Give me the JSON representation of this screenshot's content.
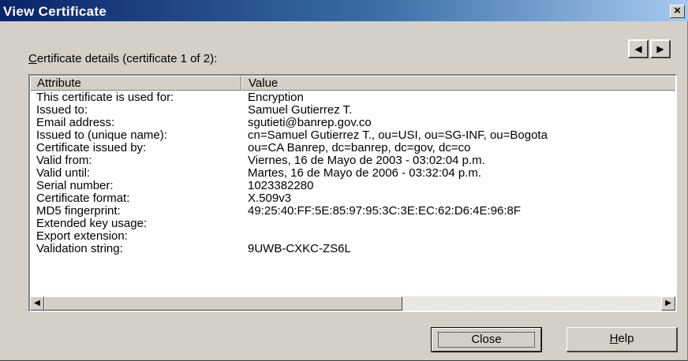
{
  "window": {
    "title": "View Certificate",
    "close_glyph": "×"
  },
  "details": {
    "label_accesskey": "C",
    "label_rest": "ertificate details (certificate 1 of 2):",
    "prev_glyph": "◀",
    "next_glyph": "▶"
  },
  "table": {
    "columns": [
      "Attribute",
      "Value"
    ],
    "rows": [
      {
        "attr": "This certificate is used for:",
        "value": "Encryption"
      },
      {
        "attr": "Issued to:",
        "value": "Samuel Gutierrez T."
      },
      {
        "attr": "Email address:",
        "value": "sgutieti@banrep.gov.co"
      },
      {
        "attr": "Issued to (unique name):",
        "value": "cn=Samuel Gutierrez T., ou=USI, ou=SG-INF, ou=Bogota"
      },
      {
        "attr": "Certificate issued by:",
        "value": "ou=CA Banrep, dc=banrep, dc=gov, dc=co"
      },
      {
        "attr": "Valid from:",
        "value": "Viernes, 16 de Mayo de 2003 - 03:02:04 p.m."
      },
      {
        "attr": "Valid until:",
        "value": "Martes, 16 de Mayo de 2006 - 03:32:04 p.m."
      },
      {
        "attr": "Serial number:",
        "value": "1023382280"
      },
      {
        "attr": "Certificate format:",
        "value": "X.509v3"
      },
      {
        "attr": "MD5 fingerprint:",
        "value": "49:25:40:FF:5E:85:97:95:3C:3E:EC:62:D6:4E:96:8F"
      },
      {
        "attr": "Extended key usage:",
        "value": ""
      },
      {
        "attr": "Export extension:",
        "value": ""
      },
      {
        "attr": "Validation string:",
        "value": "9UWB-CXKC-ZS6L"
      }
    ]
  },
  "scrollbar": {
    "left_glyph": "◀",
    "right_glyph": "▶"
  },
  "buttons": {
    "close_label": "Close",
    "help_accesskey": "H",
    "help_rest": "elp"
  }
}
